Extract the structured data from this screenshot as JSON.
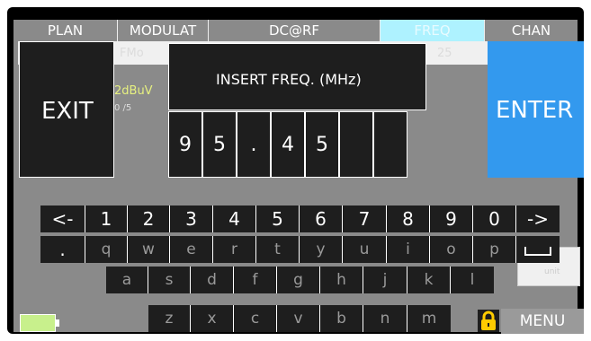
{
  "tabs": [
    {
      "label": "PLAN",
      "active": false
    },
    {
      "label": "MODULAT",
      "active": false
    },
    {
      "label": "DC@RF",
      "active": false
    },
    {
      "label": "FREQ",
      "active": true
    },
    {
      "label": "CHAN",
      "active": false
    }
  ],
  "background": {
    "fm_text": "FMo",
    "level_text": "2dBuV",
    "scale_text": "0 /5",
    "freq_fragment": "25",
    "unit_text": "unit"
  },
  "dialog": {
    "exit_label": "EXIT",
    "enter_label": "ENTER",
    "prompt": "INSERT FREQ. (MHz)",
    "digits": [
      "9",
      "5",
      ".",
      "4",
      "5",
      "",
      ""
    ]
  },
  "keyboard": {
    "row1": [
      "<-",
      "1",
      "2",
      "3",
      "4",
      "5",
      "6",
      "7",
      "8",
      "9",
      "0",
      "->"
    ],
    "row2": [
      ".",
      "q",
      "w",
      "e",
      "r",
      "t",
      "y",
      "u",
      "i",
      "o",
      "p",
      "␣"
    ],
    "row3": [
      "a",
      "s",
      "d",
      "f",
      "g",
      "h",
      "j",
      "k",
      "l"
    ],
    "row4": [
      "z",
      "x",
      "c",
      "v",
      "b",
      "n",
      "m"
    ]
  },
  "status": {
    "menu_label": "MENU",
    "battery_color": "#c8f08c",
    "lock_color": "#ffcc00"
  }
}
